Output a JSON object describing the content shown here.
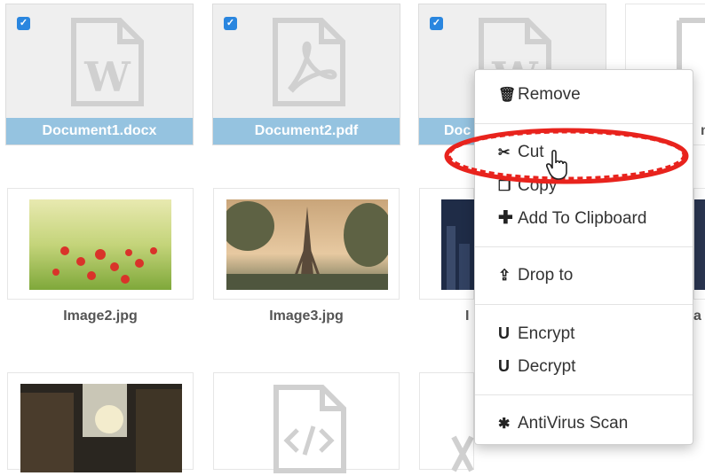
{
  "files": {
    "row1": [
      {
        "name": "Document1.docx",
        "icon": "word-document-icon",
        "selected": true
      },
      {
        "name": "Document2.pdf",
        "icon": "pdf-document-icon",
        "selected": true
      },
      {
        "name": "Doc",
        "icon": "word-document-icon",
        "selected": true
      },
      {
        "name": "m",
        "icon": "document-icon",
        "selected": false
      }
    ],
    "row2": [
      {
        "name": "Image2.jpg",
        "icon": "image-thumbnail"
      },
      {
        "name": "Image3.jpg",
        "icon": "image-thumbnail"
      },
      {
        "name": "I",
        "icon": "image-thumbnail"
      },
      {
        "name": "a",
        "icon": "image-thumbnail"
      }
    ],
    "row3": [
      {
        "icon": "image-thumbnail"
      },
      {
        "icon": "code-file-icon"
      },
      {
        "icon": "excel-file-icon"
      }
    ]
  },
  "context_menu": {
    "remove": "Remove",
    "cut": "Cut",
    "copy": "Copy",
    "add_to_clipboard": "Add To Clipboard",
    "drop_to": "Drop to",
    "encrypt": "Encrypt",
    "decrypt": "Decrypt",
    "antivirus": "AntiVirus Scan"
  },
  "colors": {
    "checkbox": "#2a86df",
    "selected_label_bar": "#95c3e0",
    "highlight_ring": "#e8231d"
  }
}
